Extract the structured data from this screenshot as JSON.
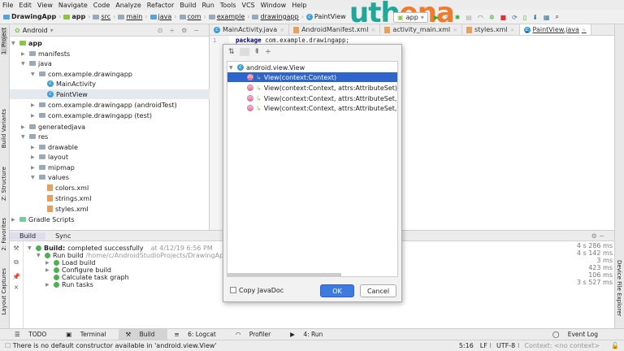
{
  "menu": [
    "File",
    "Edit",
    "View",
    "Navigate",
    "Code",
    "Analyze",
    "Refactor",
    "Build",
    "Run",
    "Tools",
    "VCS",
    "Window",
    "Help"
  ],
  "breadcrumb": [
    "DrawingApp",
    "app",
    "src",
    "main",
    "java",
    "com",
    "example",
    "drawingapp",
    "PaintView"
  ],
  "run_config": "app",
  "logo": {
    "text_a": "uth",
    "text_b": "ena",
    "color_a": "#1fa89a",
    "color_b": "#f07b2a"
  },
  "project": {
    "view": "Android",
    "tree": [
      "app",
      "manifests",
      "java",
      "com.example.drawingapp",
      "MainActivity",
      "PaintView",
      "com.example.drawingapp (androidTest)",
      "com.example.drawingapp (test)",
      "generatedjava",
      "res",
      "drawable",
      "layout",
      "mipmap",
      "values",
      "colors.xml",
      "strings.xml",
      "styles.xml",
      "Gradle Scripts"
    ]
  },
  "left_strip": [
    "1: Project",
    "Build Variants",
    "Z: Structure",
    "2: Favorites",
    "Layout Captures"
  ],
  "right_strip": [
    "Device File Explorer"
  ],
  "editor": {
    "tabs": [
      "MainActivity.java",
      "AndroidManifest.xml",
      "activity_main.xml",
      "styles.xml",
      "PaintView.java"
    ],
    "line_number": "1",
    "code_keyword": "package",
    "code_rest": " com.example.drawingapp;"
  },
  "dialog": {
    "root": "android.view.View",
    "items": [
      "View(context:Context)",
      "View(context:Context, attrs:AttributeSet)",
      "View(context:Context, attrs:AttributeSet, de",
      "View(context:Context, attrs:AttributeSet, de"
    ],
    "copy_javadoc": "Copy JavaDoc",
    "ok": "OK",
    "cancel": "Cancel"
  },
  "build": {
    "tabs": [
      "Build",
      "Sync"
    ],
    "rows": [
      {
        "label": "Build:",
        "rest": " completed successfully",
        "meta": "at 4/12/19 6:56 PM",
        "time": "4 s 286 ms"
      },
      {
        "label": "Run build",
        "rest": "",
        "meta": "/home/c/AndroidStudioProjects/DrawingApp",
        "time": "4 s 142 ms"
      },
      {
        "label": "Load build",
        "rest": "",
        "meta": "",
        "time": "3 ms"
      },
      {
        "label": "Configure build",
        "rest": "",
        "meta": "",
        "time": "423 ms"
      },
      {
        "label": "Calculate task graph",
        "rest": "",
        "meta": "",
        "time": "106 ms"
      },
      {
        "label": "Run tasks",
        "rest": "",
        "meta": "",
        "time": "3 s 527 ms"
      }
    ]
  },
  "tool_windows": [
    "TODO",
    "Terminal",
    "Build",
    "6: Logcat",
    "Profiler",
    "4: Run"
  ],
  "event_log": "Event Log",
  "status": {
    "message": "There is no default constructor available in 'android.view.View'",
    "position": "5:16",
    "line_sep": "LF",
    "encoding": "UTF-8",
    "context": "Context: <no context>"
  }
}
